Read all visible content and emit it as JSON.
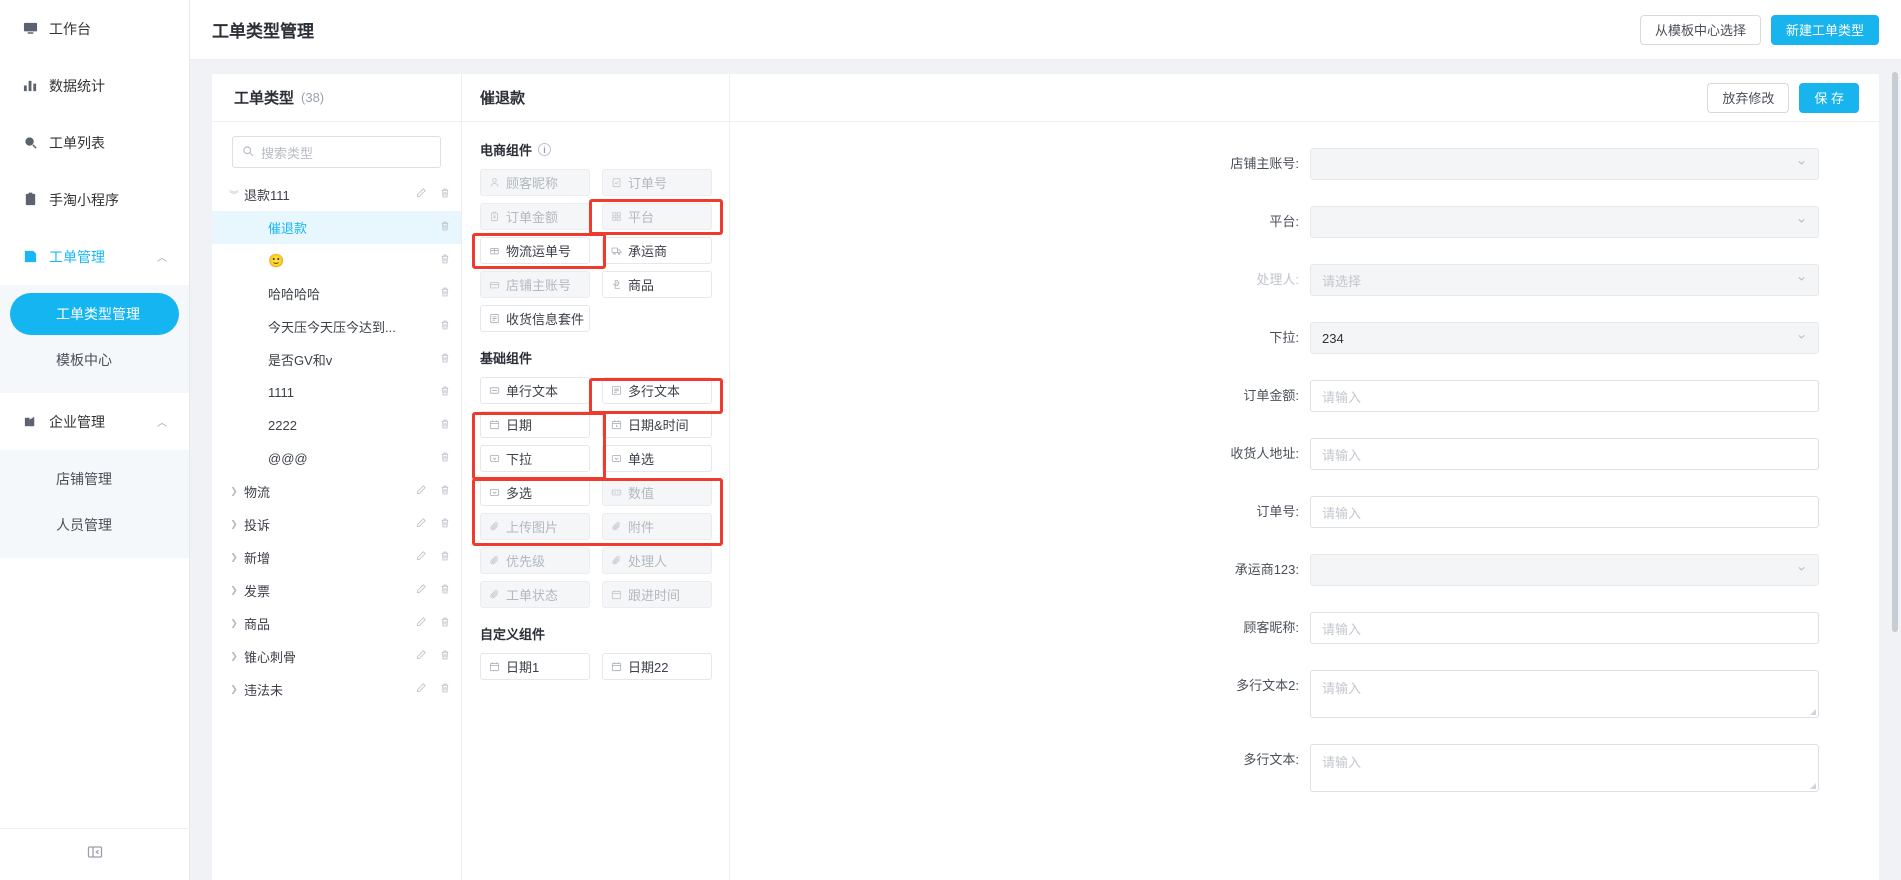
{
  "sidebar": {
    "items": [
      {
        "label": "工作台",
        "icon": "monitor-icon",
        "active": false,
        "caret": null
      },
      {
        "label": "数据统计",
        "icon": "bar-chart-icon",
        "active": false,
        "caret": null
      },
      {
        "label": "工单列表",
        "icon": "search-circle-icon",
        "active": false,
        "caret": null
      },
      {
        "label": "手淘小程序",
        "icon": "clipboard-icon",
        "active": false,
        "caret": null
      },
      {
        "label": "工单管理",
        "icon": "ticket-icon",
        "active": true,
        "caret": "︿"
      }
    ],
    "ticket_sub": [
      {
        "label": "工单类型管理",
        "selected": true
      },
      {
        "label": "模板中心",
        "selected": false
      }
    ],
    "enterprise": {
      "label": "企业管理",
      "icon": "building-icon",
      "caret": "︿"
    },
    "enterprise_sub": [
      {
        "label": "店铺管理",
        "selected": false
      },
      {
        "label": "人员管理",
        "selected": false
      }
    ],
    "collapse_icon": "collapse-panel-icon"
  },
  "topbar": {
    "title": "工单类型管理",
    "template_center_btn": "从模板中心选择",
    "new_type_btn": "新建工单类型"
  },
  "list_panel": {
    "title": "工单类型",
    "count": "(38)",
    "search_placeholder": "搜索类型",
    "search_icon": "search-icon",
    "rows": [
      {
        "label": "退款111",
        "arrow": "︾",
        "indent": false,
        "selected": false,
        "edit": true,
        "delete": true
      },
      {
        "label": "催退款",
        "arrow": "",
        "indent": true,
        "selected": true,
        "edit": false,
        "delete": true
      },
      {
        "label": "🙂",
        "arrow": "",
        "indent": true,
        "selected": false,
        "edit": false,
        "delete": true
      },
      {
        "label": "哈哈哈哈",
        "arrow": "",
        "indent": true,
        "selected": false,
        "edit": false,
        "delete": true
      },
      {
        "label": "今天压今天压今达到...",
        "arrow": "",
        "indent": true,
        "selected": false,
        "edit": false,
        "delete": true
      },
      {
        "label": "是否GV和v",
        "arrow": "",
        "indent": true,
        "selected": false,
        "edit": false,
        "delete": true
      },
      {
        "label": "1111",
        "arrow": "",
        "indent": true,
        "selected": false,
        "edit": false,
        "delete": true
      },
      {
        "label": "2222",
        "arrow": "",
        "indent": true,
        "selected": false,
        "edit": false,
        "delete": true
      },
      {
        "label": "@@@",
        "arrow": "",
        "indent": true,
        "selected": false,
        "edit": false,
        "delete": true
      },
      {
        "label": "物流",
        "arrow": "❯",
        "indent": false,
        "selected": false,
        "edit": true,
        "delete": true
      },
      {
        "label": "投诉",
        "arrow": "❯",
        "indent": false,
        "selected": false,
        "edit": true,
        "delete": true
      },
      {
        "label": "新增",
        "arrow": "❯",
        "indent": false,
        "selected": false,
        "edit": true,
        "delete": true
      },
      {
        "label": "发票",
        "arrow": "❯",
        "indent": false,
        "selected": false,
        "edit": true,
        "delete": true
      },
      {
        "label": "商品",
        "arrow": "❯",
        "indent": false,
        "selected": false,
        "edit": true,
        "delete": true
      },
      {
        "label": "锥心刺骨",
        "arrow": "❯",
        "indent": false,
        "selected": false,
        "edit": true,
        "delete": true
      },
      {
        "label": "违法未",
        "arrow": "❯",
        "indent": false,
        "selected": false,
        "edit": true,
        "delete": true
      }
    ]
  },
  "palette": {
    "title": "催退款",
    "discard_btn": "放弃修改",
    "save_btn": "保 存",
    "section_ecom": "电商组件",
    "section_ecom_info_icon": "info-icon",
    "ecom_items": [
      {
        "label": "顾客昵称",
        "icon": "user-icon",
        "disabled": true
      },
      {
        "label": "订单号",
        "icon": "clipboard-check-icon",
        "disabled": true
      },
      {
        "label": "订单金额",
        "icon": "money-bag-icon",
        "disabled": true
      },
      {
        "label": "平台",
        "icon": "grid-icon",
        "disabled": true
      },
      {
        "label": "物流运单号",
        "icon": "package-icon",
        "disabled": false
      },
      {
        "label": "承运商",
        "icon": "truck-icon",
        "disabled": false
      },
      {
        "label": "店铺主账号",
        "icon": "store-icon",
        "disabled": true
      },
      {
        "label": "商品",
        "icon": "puzzle-icon",
        "disabled": false
      },
      {
        "label": "收货信息套件",
        "icon": "receipt-icon",
        "disabled": false
      }
    ],
    "section_basic": "基础组件",
    "basic_items": [
      {
        "label": "单行文本",
        "icon": "text-line-icon",
        "disabled": false
      },
      {
        "label": "多行文本",
        "icon": "text-area-icon",
        "disabled": false
      },
      {
        "label": "日期",
        "icon": "calendar-icon",
        "disabled": false
      },
      {
        "label": "日期&时间",
        "icon": "calendar-clock-icon",
        "disabled": false
      },
      {
        "label": "下拉",
        "icon": "dropdown-icon",
        "disabled": false
      },
      {
        "label": "单选",
        "icon": "radio-icon",
        "disabled": false
      },
      {
        "label": "多选",
        "icon": "checkbox-icon",
        "disabled": false
      },
      {
        "label": "数值",
        "icon": "number-icon",
        "disabled": true
      },
      {
        "label": "上传图片",
        "icon": "paperclip-icon",
        "disabled": true
      },
      {
        "label": "附件",
        "icon": "paperclip-icon",
        "disabled": true
      },
      {
        "label": "优先级",
        "icon": "paperclip-icon",
        "disabled": true
      },
      {
        "label": "处理人",
        "icon": "paperclip-icon",
        "disabled": true
      },
      {
        "label": "工单状态",
        "icon": "paperclip-icon",
        "disabled": true
      },
      {
        "label": "跟进时间",
        "icon": "calendar-icon",
        "disabled": true
      }
    ],
    "section_custom": "自定义组件",
    "custom_items": [
      {
        "label": "日期1",
        "icon": "calendar-icon",
        "disabled": false
      },
      {
        "label": "日期22",
        "icon": "calendar-icon",
        "disabled": false
      }
    ]
  },
  "form": {
    "fields": [
      {
        "label": "店铺主账号:",
        "type": "select",
        "value": "",
        "placeholder": "",
        "disabled": true,
        "label_dim": false
      },
      {
        "label": "平台:",
        "type": "select",
        "value": "",
        "placeholder": "",
        "disabled": true,
        "label_dim": false
      },
      {
        "label": "处理人:",
        "type": "select",
        "value": "",
        "placeholder": "请选择",
        "disabled": true,
        "label_dim": true
      },
      {
        "label": "下拉:",
        "type": "select",
        "value": "234",
        "placeholder": "",
        "disabled": true,
        "label_dim": false
      },
      {
        "label": "订单金额:",
        "type": "input",
        "value": "",
        "placeholder": "请输入",
        "disabled": false,
        "label_dim": false
      },
      {
        "label": "收货人地址:",
        "type": "input",
        "value": "",
        "placeholder": "请输入",
        "disabled": false,
        "label_dim": false
      },
      {
        "label": "订单号:",
        "type": "input",
        "value": "",
        "placeholder": "请输入",
        "disabled": false,
        "label_dim": false
      },
      {
        "label": "承运商123:",
        "type": "select",
        "value": "",
        "placeholder": "",
        "disabled": true,
        "label_dim": false
      },
      {
        "label": "顾客昵称:",
        "type": "input",
        "value": "",
        "placeholder": "请输入",
        "disabled": false,
        "label_dim": false
      },
      {
        "label": "多行文本2:",
        "type": "textarea",
        "value": "",
        "placeholder": "请输入",
        "disabled": false,
        "label_dim": false
      },
      {
        "label": "多行文本:",
        "type": "textarea",
        "value": "",
        "placeholder": "请输入",
        "disabled": false,
        "label_dim": false
      }
    ]
  },
  "colors": {
    "accent": "#18b4ed",
    "annotation": "#ef3b2d",
    "selected_row_bg": "#e8f6fe"
  }
}
